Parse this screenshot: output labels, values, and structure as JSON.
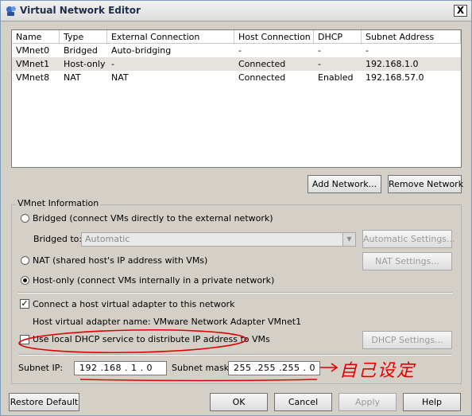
{
  "window": {
    "title": "Virtual Network Editor",
    "close_label": "X"
  },
  "network_list": {
    "columns": [
      "Name",
      "Type",
      "External Connection",
      "Host Connection",
      "DHCP",
      "Subnet Address"
    ],
    "rows": [
      {
        "name": "VMnet0",
        "type": "Bridged",
        "external": "Auto-bridging",
        "host": "-",
        "dhcp": "-",
        "subnet": "-",
        "selected": false
      },
      {
        "name": "VMnet1",
        "type": "Host-only",
        "external": "-",
        "host": "Connected",
        "dhcp": "-",
        "subnet": "192.168.1.0",
        "selected": true
      },
      {
        "name": "VMnet8",
        "type": "NAT",
        "external": "NAT",
        "host": "Connected",
        "dhcp": "Enabled",
        "subnet": "192.168.57.0",
        "selected": false
      }
    ]
  },
  "buttons": {
    "add_network": "Add Network...",
    "remove_network": "Remove Network",
    "automatic_settings": "Automatic Settings...",
    "nat_settings": "NAT Settings...",
    "dhcp_settings": "DHCP Settings...",
    "restore_default": "Restore Default",
    "ok": "OK",
    "cancel": "Cancel",
    "apply": "Apply",
    "help": "Help"
  },
  "vmnet_info": {
    "group_label": "VMnet Information",
    "bridged_label": "Bridged (connect VMs directly to the external network)",
    "bridged_to_label": "Bridged to:",
    "bridged_to_value": "Automatic",
    "nat_label": "NAT (shared host's IP address with VMs)",
    "hostonly_label": "Host-only (connect VMs internally in a private network)",
    "selected_mode": "Host-only",
    "connect_adapter_label": "Connect a host virtual adapter to this network",
    "connect_adapter_checked": true,
    "adapter_name_label": "Host virtual adapter name: VMware Network Adapter VMnet1",
    "dhcp_label": "Use local DHCP service to distribute IP address to VMs",
    "dhcp_checked": false,
    "subnet_ip_label": "Subnet IP:",
    "subnet_ip_value": "192 .168 . 1 . 0",
    "subnet_mask_label": "Subnet mask:",
    "subnet_mask_value": "255 .255 .255 . 0"
  },
  "annotation": {
    "text": "自己设定",
    "color": "#e10000"
  }
}
